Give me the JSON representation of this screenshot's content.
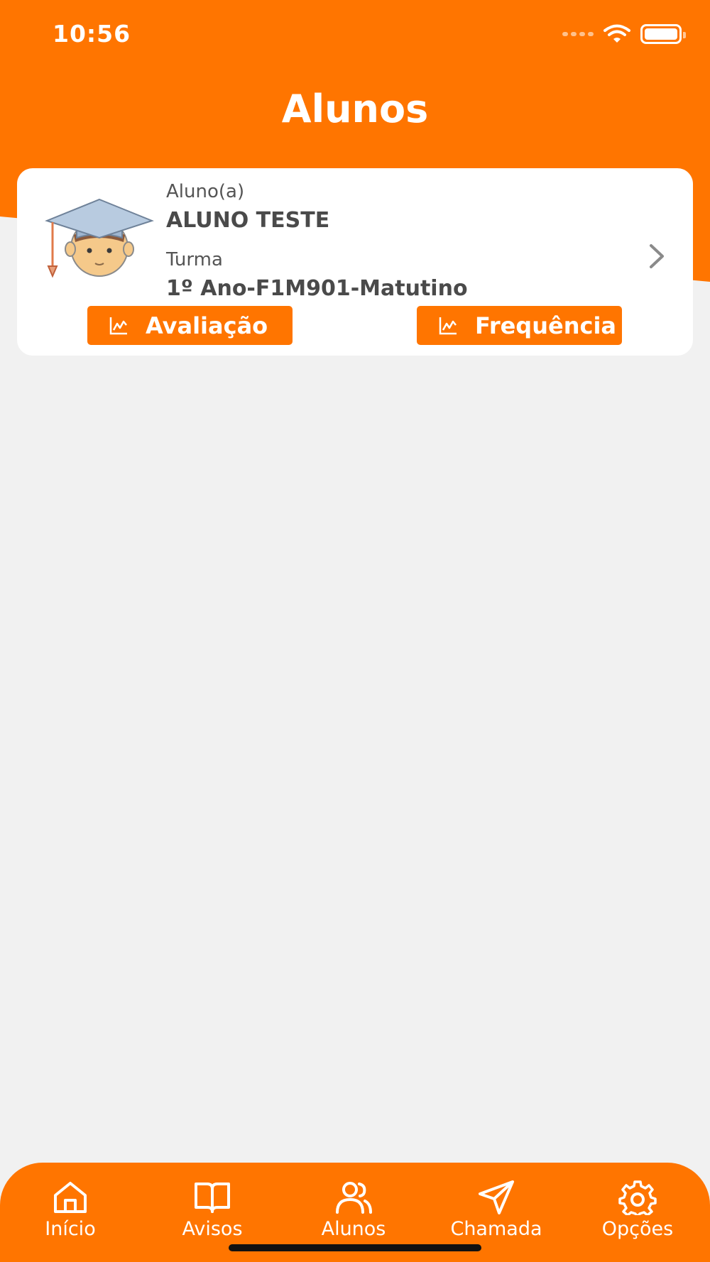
{
  "status_bar": {
    "time": "10:56"
  },
  "header": {
    "title": "Alunos"
  },
  "student_card": {
    "student_label": "Aluno(a)",
    "student_name": "ALUNO TESTE",
    "class_label": "Turma",
    "class_name": "1º Ano-F1M901-Matutino",
    "buttons": {
      "evaluation_label": "Avaliação",
      "attendance_label": "Frequência"
    },
    "icons": {
      "avatar": "graduate-avatar-icon",
      "chevron": "chevron-right-icon",
      "chart": "line-chart-icon"
    }
  },
  "tabbar": {
    "items": [
      {
        "label": "Início",
        "icon": "home-icon"
      },
      {
        "label": "Avisos",
        "icon": "book-icon"
      },
      {
        "label": "Alunos",
        "icon": "users-icon"
      },
      {
        "label": "Chamada",
        "icon": "send-icon"
      },
      {
        "label": "Opções",
        "icon": "gear-icon"
      }
    ]
  },
  "colors": {
    "brand": "#ff7500",
    "background": "#f1f1f1",
    "card": "#ffffff",
    "text": "#4a4a4a"
  }
}
